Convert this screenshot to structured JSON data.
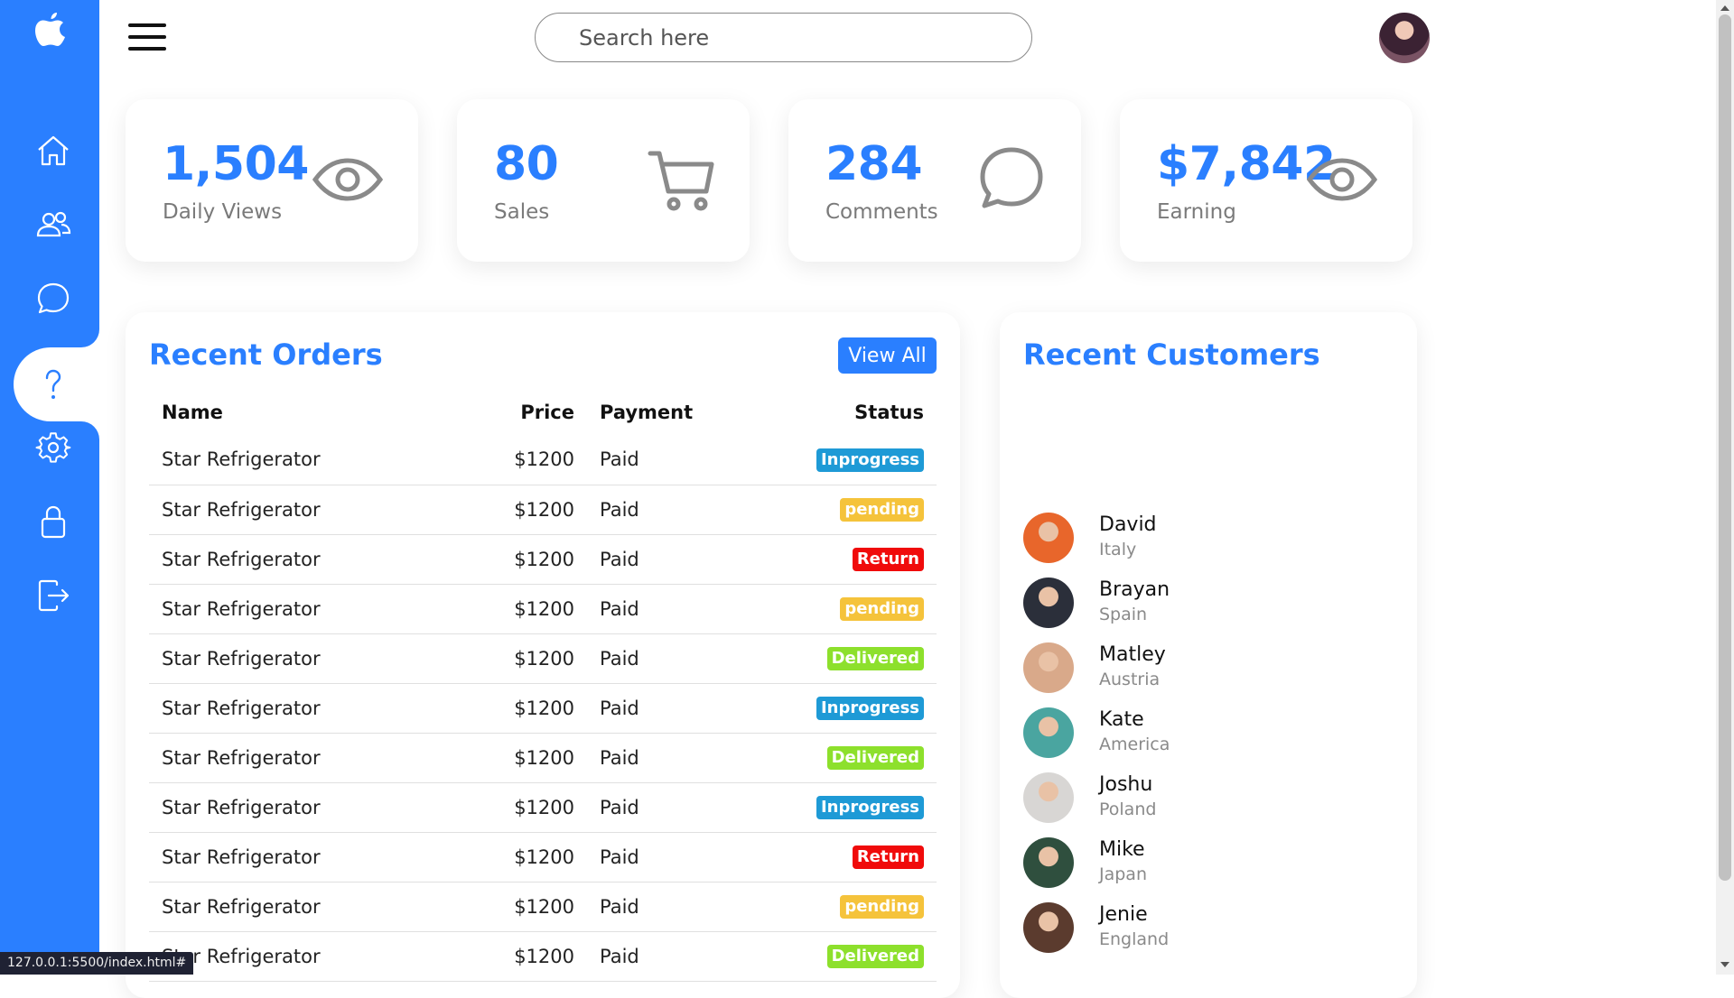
{
  "search": {
    "placeholder": "Search here"
  },
  "sidebar": {
    "items": [
      {
        "name": "home"
      },
      {
        "name": "customers"
      },
      {
        "name": "messages"
      },
      {
        "name": "help"
      },
      {
        "name": "settings"
      },
      {
        "name": "password"
      },
      {
        "name": "sign-out"
      }
    ],
    "active": "help",
    "accent": "#2a7fff"
  },
  "cards": [
    {
      "number": "1,504",
      "label": "Daily Views",
      "icon": "eye-icon"
    },
    {
      "number": "80",
      "label": "Sales",
      "icon": "cart-icon"
    },
    {
      "number": "284",
      "label": "Comments",
      "icon": "chat-icon"
    },
    {
      "number": "$7,842",
      "label": "Earning",
      "icon": "eye-icon"
    }
  ],
  "orders": {
    "title": "Recent Orders",
    "view_all": "View All",
    "headers": {
      "name": "Name",
      "price": "Price",
      "payment": "Payment",
      "status": "Status"
    },
    "rows": [
      {
        "name": "Star Refrigerator",
        "price": "$1200",
        "payment": "Paid",
        "status": "Inprogress",
        "status_color": "#1e9ad6"
      },
      {
        "name": "Star Refrigerator",
        "price": "$1200",
        "payment": "Paid",
        "status": "pending",
        "status_color": "#f5c33b"
      },
      {
        "name": "Star Refrigerator",
        "price": "$1200",
        "payment": "Paid",
        "status": "Return",
        "status_color": "#f00b0b"
      },
      {
        "name": "Star Refrigerator",
        "price": "$1200",
        "payment": "Paid",
        "status": "pending",
        "status_color": "#f5c33b"
      },
      {
        "name": "Star Refrigerator",
        "price": "$1200",
        "payment": "Paid",
        "status": "Delivered",
        "status_color": "#8de02c"
      },
      {
        "name": "Star Refrigerator",
        "price": "$1200",
        "payment": "Paid",
        "status": "Inprogress",
        "status_color": "#1e9ad6"
      },
      {
        "name": "Star Refrigerator",
        "price": "$1200",
        "payment": "Paid",
        "status": "Delivered",
        "status_color": "#8de02c"
      },
      {
        "name": "Star Refrigerator",
        "price": "$1200",
        "payment": "Paid",
        "status": "Inprogress",
        "status_color": "#1e9ad6"
      },
      {
        "name": "Star Refrigerator",
        "price": "$1200",
        "payment": "Paid",
        "status": "Return",
        "status_color": "#f00b0b"
      },
      {
        "name": "Star Refrigerator",
        "price": "$1200",
        "payment": "Paid",
        "status": "pending",
        "status_color": "#f5c33b"
      },
      {
        "name": "Star Refrigerator",
        "price": "$1200",
        "payment": "Paid",
        "status": "Delivered",
        "status_color": "#8de02c"
      }
    ]
  },
  "customers": {
    "title": "Recent Customers",
    "list": [
      {
        "name": "David",
        "country": "Italy",
        "avatar_color": "#e8662b"
      },
      {
        "name": "Brayan",
        "country": "Spain",
        "avatar_color": "#2b2f3a"
      },
      {
        "name": "Matley",
        "country": "Austria",
        "avatar_color": "#d9a98a"
      },
      {
        "name": "Kate",
        "country": "America",
        "avatar_color": "#4aa5a0"
      },
      {
        "name": "Joshu",
        "country": "Poland",
        "avatar_color": "#d8d6d4"
      },
      {
        "name": "Mike",
        "country": "Japan",
        "avatar_color": "#2f4f3e"
      },
      {
        "name": "Jenie",
        "country": "England",
        "avatar_color": "#5b3b2e"
      }
    ]
  },
  "status_bar": {
    "url": "127.0.0.1:5500/index.html#"
  }
}
